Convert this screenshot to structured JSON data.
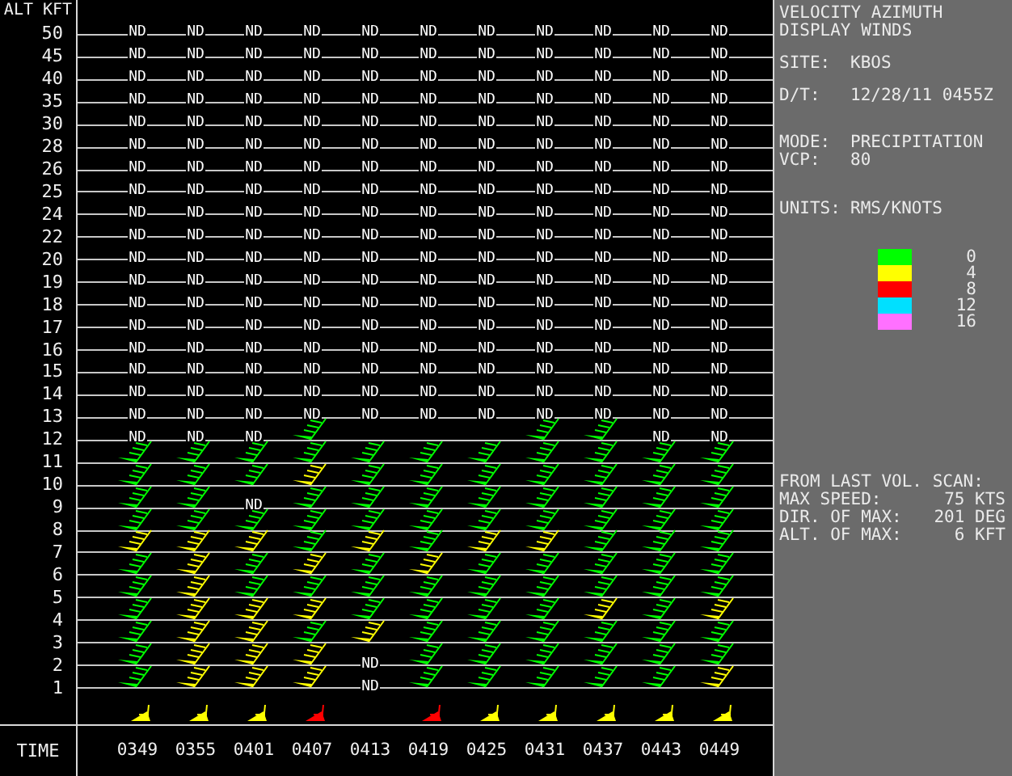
{
  "axis": {
    "title": "ALT KFT",
    "time_label": "TIME"
  },
  "times": [
    "0349",
    "0355",
    "0401",
    "0407",
    "0413",
    "0419",
    "0425",
    "0431",
    "0437",
    "0443",
    "0449"
  ],
  "rows": [
    {
      "label": "50",
      "cells": [
        {
          "kind": "nd",
          "text": "ND"
        },
        {
          "kind": "nd",
          "text": "ND"
        },
        {
          "kind": "nd",
          "text": "ND"
        },
        {
          "kind": "nd",
          "text": "ND"
        },
        {
          "kind": "nd",
          "text": "ND"
        },
        {
          "kind": "nd",
          "text": "ND"
        },
        {
          "kind": "nd",
          "text": "ND"
        },
        {
          "kind": "nd",
          "text": "ND"
        },
        {
          "kind": "nd",
          "text": "ND"
        },
        {
          "kind": "nd",
          "text": "ND"
        },
        {
          "kind": "nd",
          "text": "ND"
        }
      ]
    },
    {
      "label": "45",
      "cells": [
        {
          "kind": "nd",
          "text": "ND"
        },
        {
          "kind": "nd",
          "text": "ND"
        },
        {
          "kind": "nd",
          "text": "ND"
        },
        {
          "kind": "nd",
          "text": "ND"
        },
        {
          "kind": "nd",
          "text": "ND"
        },
        {
          "kind": "nd",
          "text": "ND"
        },
        {
          "kind": "nd",
          "text": "ND"
        },
        {
          "kind": "nd",
          "text": "ND"
        },
        {
          "kind": "nd",
          "text": "ND"
        },
        {
          "kind": "nd",
          "text": "ND"
        },
        {
          "kind": "nd",
          "text": "ND"
        }
      ]
    },
    {
      "label": "40",
      "cells": [
        {
          "kind": "nd",
          "text": "ND"
        },
        {
          "kind": "nd",
          "text": "ND"
        },
        {
          "kind": "nd",
          "text": "ND"
        },
        {
          "kind": "nd",
          "text": "ND"
        },
        {
          "kind": "nd",
          "text": "ND"
        },
        {
          "kind": "nd",
          "text": "ND"
        },
        {
          "kind": "nd",
          "text": "ND"
        },
        {
          "kind": "nd",
          "text": "ND"
        },
        {
          "kind": "nd",
          "text": "ND"
        },
        {
          "kind": "nd",
          "text": "ND"
        },
        {
          "kind": "nd",
          "text": "ND"
        }
      ]
    },
    {
      "label": "35",
      "cells": [
        {
          "kind": "nd",
          "text": "ND"
        },
        {
          "kind": "nd",
          "text": "ND"
        },
        {
          "kind": "nd",
          "text": "ND"
        },
        {
          "kind": "nd",
          "text": "ND"
        },
        {
          "kind": "nd",
          "text": "ND"
        },
        {
          "kind": "nd",
          "text": "ND"
        },
        {
          "kind": "nd",
          "text": "ND"
        },
        {
          "kind": "nd",
          "text": "ND"
        },
        {
          "kind": "nd",
          "text": "ND"
        },
        {
          "kind": "nd",
          "text": "ND"
        },
        {
          "kind": "nd",
          "text": "ND"
        }
      ]
    },
    {
      "label": "30",
      "cells": [
        {
          "kind": "nd",
          "text": "ND"
        },
        {
          "kind": "nd",
          "text": "ND"
        },
        {
          "kind": "nd",
          "text": "ND"
        },
        {
          "kind": "nd",
          "text": "ND"
        },
        {
          "kind": "nd",
          "text": "ND"
        },
        {
          "kind": "nd",
          "text": "ND"
        },
        {
          "kind": "nd",
          "text": "ND"
        },
        {
          "kind": "nd",
          "text": "ND"
        },
        {
          "kind": "nd",
          "text": "ND"
        },
        {
          "kind": "nd",
          "text": "ND"
        },
        {
          "kind": "nd",
          "text": "ND"
        }
      ]
    },
    {
      "label": "28",
      "cells": [
        {
          "kind": "nd",
          "text": "ND"
        },
        {
          "kind": "nd",
          "text": "ND"
        },
        {
          "kind": "nd",
          "text": "ND"
        },
        {
          "kind": "nd",
          "text": "ND"
        },
        {
          "kind": "nd",
          "text": "ND"
        },
        {
          "kind": "nd",
          "text": "ND"
        },
        {
          "kind": "nd",
          "text": "ND"
        },
        {
          "kind": "nd",
          "text": "ND"
        },
        {
          "kind": "nd",
          "text": "ND"
        },
        {
          "kind": "nd",
          "text": "ND"
        },
        {
          "kind": "nd",
          "text": "ND"
        }
      ]
    },
    {
      "label": "26",
      "cells": [
        {
          "kind": "nd",
          "text": "ND"
        },
        {
          "kind": "nd",
          "text": "ND"
        },
        {
          "kind": "nd",
          "text": "ND"
        },
        {
          "kind": "nd",
          "text": "ND"
        },
        {
          "kind": "nd",
          "text": "ND"
        },
        {
          "kind": "nd",
          "text": "ND"
        },
        {
          "kind": "nd",
          "text": "ND"
        },
        {
          "kind": "nd",
          "text": "ND"
        },
        {
          "kind": "nd",
          "text": "ND"
        },
        {
          "kind": "nd",
          "text": "ND"
        },
        {
          "kind": "nd",
          "text": "ND"
        }
      ]
    },
    {
      "label": "25",
      "cells": [
        {
          "kind": "nd",
          "text": "ND"
        },
        {
          "kind": "nd",
          "text": "ND"
        },
        {
          "kind": "nd",
          "text": "ND"
        },
        {
          "kind": "nd",
          "text": "ND"
        },
        {
          "kind": "nd",
          "text": "ND"
        },
        {
          "kind": "nd",
          "text": "ND"
        },
        {
          "kind": "nd",
          "text": "ND"
        },
        {
          "kind": "nd",
          "text": "ND"
        },
        {
          "kind": "nd",
          "text": "ND"
        },
        {
          "kind": "nd",
          "text": "ND"
        },
        {
          "kind": "nd",
          "text": "ND"
        }
      ]
    },
    {
      "label": "24",
      "cells": [
        {
          "kind": "nd",
          "text": "ND"
        },
        {
          "kind": "nd",
          "text": "ND"
        },
        {
          "kind": "nd",
          "text": "ND"
        },
        {
          "kind": "nd",
          "text": "ND"
        },
        {
          "kind": "nd",
          "text": "ND"
        },
        {
          "kind": "nd",
          "text": "ND"
        },
        {
          "kind": "nd",
          "text": "ND"
        },
        {
          "kind": "nd",
          "text": "ND"
        },
        {
          "kind": "nd",
          "text": "ND"
        },
        {
          "kind": "nd",
          "text": "ND"
        },
        {
          "kind": "nd",
          "text": "ND"
        }
      ]
    },
    {
      "label": "22",
      "cells": [
        {
          "kind": "nd",
          "text": "ND"
        },
        {
          "kind": "nd",
          "text": "ND"
        },
        {
          "kind": "nd",
          "text": "ND"
        },
        {
          "kind": "nd",
          "text": "ND"
        },
        {
          "kind": "nd",
          "text": "ND"
        },
        {
          "kind": "nd",
          "text": "ND"
        },
        {
          "kind": "nd",
          "text": "ND"
        },
        {
          "kind": "nd",
          "text": "ND"
        },
        {
          "kind": "nd",
          "text": "ND"
        },
        {
          "kind": "nd",
          "text": "ND"
        },
        {
          "kind": "nd",
          "text": "ND"
        }
      ]
    },
    {
      "label": "20",
      "cells": [
        {
          "kind": "nd",
          "text": "ND"
        },
        {
          "kind": "nd",
          "text": "ND"
        },
        {
          "kind": "nd",
          "text": "ND"
        },
        {
          "kind": "nd",
          "text": "ND"
        },
        {
          "kind": "nd",
          "text": "ND"
        },
        {
          "kind": "nd",
          "text": "ND"
        },
        {
          "kind": "nd",
          "text": "ND"
        },
        {
          "kind": "nd",
          "text": "ND"
        },
        {
          "kind": "nd",
          "text": "ND"
        },
        {
          "kind": "nd",
          "text": "ND"
        },
        {
          "kind": "nd",
          "text": "ND"
        }
      ]
    },
    {
      "label": "19",
      "cells": [
        {
          "kind": "nd",
          "text": "ND"
        },
        {
          "kind": "nd",
          "text": "ND"
        },
        {
          "kind": "nd",
          "text": "ND"
        },
        {
          "kind": "nd",
          "text": "ND"
        },
        {
          "kind": "nd",
          "text": "ND"
        },
        {
          "kind": "nd",
          "text": "ND"
        },
        {
          "kind": "nd",
          "text": "ND"
        },
        {
          "kind": "nd",
          "text": "ND"
        },
        {
          "kind": "nd",
          "text": "ND"
        },
        {
          "kind": "nd",
          "text": "ND"
        },
        {
          "kind": "nd",
          "text": "ND"
        }
      ]
    },
    {
      "label": "18",
      "cells": [
        {
          "kind": "nd",
          "text": "ND"
        },
        {
          "kind": "nd",
          "text": "ND"
        },
        {
          "kind": "nd",
          "text": "ND"
        },
        {
          "kind": "nd",
          "text": "ND"
        },
        {
          "kind": "nd",
          "text": "ND"
        },
        {
          "kind": "nd",
          "text": "ND"
        },
        {
          "kind": "nd",
          "text": "ND"
        },
        {
          "kind": "nd",
          "text": "ND"
        },
        {
          "kind": "nd",
          "text": "ND"
        },
        {
          "kind": "nd",
          "text": "ND"
        },
        {
          "kind": "nd",
          "text": "ND"
        }
      ]
    },
    {
      "label": "17",
      "cells": [
        {
          "kind": "nd",
          "text": "ND"
        },
        {
          "kind": "nd",
          "text": "ND"
        },
        {
          "kind": "nd",
          "text": "ND"
        },
        {
          "kind": "nd",
          "text": "ND"
        },
        {
          "kind": "nd",
          "text": "ND"
        },
        {
          "kind": "nd",
          "text": "ND"
        },
        {
          "kind": "nd",
          "text": "ND"
        },
        {
          "kind": "nd",
          "text": "ND"
        },
        {
          "kind": "nd",
          "text": "ND"
        },
        {
          "kind": "nd",
          "text": "ND"
        },
        {
          "kind": "nd",
          "text": "ND"
        }
      ]
    },
    {
      "label": "16",
      "cells": [
        {
          "kind": "nd",
          "text": "ND"
        },
        {
          "kind": "nd",
          "text": "ND"
        },
        {
          "kind": "nd",
          "text": "ND"
        },
        {
          "kind": "nd",
          "text": "ND"
        },
        {
          "kind": "nd",
          "text": "ND"
        },
        {
          "kind": "nd",
          "text": "ND"
        },
        {
          "kind": "nd",
          "text": "ND"
        },
        {
          "kind": "nd",
          "text": "ND"
        },
        {
          "kind": "nd",
          "text": "ND"
        },
        {
          "kind": "nd",
          "text": "ND"
        },
        {
          "kind": "nd",
          "text": "ND"
        }
      ]
    },
    {
      "label": "15",
      "cells": [
        {
          "kind": "nd",
          "text": "ND"
        },
        {
          "kind": "nd",
          "text": "ND"
        },
        {
          "kind": "nd",
          "text": "ND"
        },
        {
          "kind": "nd",
          "text": "ND"
        },
        {
          "kind": "nd",
          "text": "ND"
        },
        {
          "kind": "nd",
          "text": "ND"
        },
        {
          "kind": "nd",
          "text": "ND"
        },
        {
          "kind": "nd",
          "text": "ND"
        },
        {
          "kind": "nd",
          "text": "ND"
        },
        {
          "kind": "nd",
          "text": "ND"
        },
        {
          "kind": "nd",
          "text": "ND"
        }
      ]
    },
    {
      "label": "14",
      "cells": [
        {
          "kind": "nd",
          "text": "ND"
        },
        {
          "kind": "nd",
          "text": "ND"
        },
        {
          "kind": "nd",
          "text": "ND"
        },
        {
          "kind": "nd",
          "text": "ND"
        },
        {
          "kind": "nd",
          "text": "ND"
        },
        {
          "kind": "nd",
          "text": "ND"
        },
        {
          "kind": "nd",
          "text": "ND"
        },
        {
          "kind": "nd",
          "text": "ND"
        },
        {
          "kind": "nd",
          "text": "ND"
        },
        {
          "kind": "nd",
          "text": "ND"
        },
        {
          "kind": "nd",
          "text": "ND"
        }
      ]
    },
    {
      "label": "13",
      "cells": [
        {
          "kind": "nd",
          "text": "ND"
        },
        {
          "kind": "nd",
          "text": "ND"
        },
        {
          "kind": "nd",
          "text": "ND"
        },
        {
          "kind": "nd",
          "text": "ND"
        },
        {
          "kind": "nd",
          "text": "ND"
        },
        {
          "kind": "nd",
          "text": "ND"
        },
        {
          "kind": "nd",
          "text": "ND"
        },
        {
          "kind": "nd",
          "text": "ND"
        },
        {
          "kind": "nd",
          "text": "ND"
        },
        {
          "kind": "nd",
          "text": "ND"
        },
        {
          "kind": "nd",
          "text": "ND"
        }
      ]
    },
    {
      "label": "12",
      "cells": [
        {
          "kind": "nd",
          "text": "ND"
        },
        {
          "kind": "nd",
          "text": "ND"
        },
        {
          "kind": "nd",
          "text": "ND"
        },
        {
          "kind": "barb",
          "color": "#00ff00"
        },
        {
          "kind": "none"
        },
        {
          "kind": "none"
        },
        {
          "kind": "none"
        },
        {
          "kind": "barb",
          "color": "#00ff00"
        },
        {
          "kind": "barb",
          "color": "#00ff00"
        },
        {
          "kind": "nd",
          "text": "ND"
        },
        {
          "kind": "nd",
          "text": "ND"
        }
      ]
    },
    {
      "label": "11",
      "cells": [
        {
          "kind": "barb",
          "color": "#00ff00"
        },
        {
          "kind": "barb",
          "color": "#00ff00"
        },
        {
          "kind": "barb",
          "color": "#00ff00"
        },
        {
          "kind": "barb",
          "color": "#00ff00"
        },
        {
          "kind": "barb",
          "color": "#00ff00"
        },
        {
          "kind": "barb",
          "color": "#00ff00"
        },
        {
          "kind": "barb",
          "color": "#00ff00"
        },
        {
          "kind": "barb",
          "color": "#00ff00"
        },
        {
          "kind": "barb",
          "color": "#00ff00"
        },
        {
          "kind": "barb",
          "color": "#00ff00"
        },
        {
          "kind": "barb",
          "color": "#00ff00"
        }
      ]
    },
    {
      "label": "10",
      "cells": [
        {
          "kind": "barb",
          "color": "#00ff00"
        },
        {
          "kind": "barb",
          "color": "#00ff00"
        },
        {
          "kind": "barb",
          "color": "#00ff00"
        },
        {
          "kind": "barb",
          "color": "#ffff00"
        },
        {
          "kind": "barb",
          "color": "#00ff00"
        },
        {
          "kind": "barb",
          "color": "#00ff00"
        },
        {
          "kind": "barb",
          "color": "#00ff00"
        },
        {
          "kind": "barb",
          "color": "#00ff00"
        },
        {
          "kind": "barb",
          "color": "#00ff00"
        },
        {
          "kind": "barb",
          "color": "#00ff00"
        },
        {
          "kind": "barb",
          "color": "#00ff00"
        }
      ]
    },
    {
      "label": "9",
      "cells": [
        {
          "kind": "barb",
          "color": "#00ff00"
        },
        {
          "kind": "barb",
          "color": "#00ff00"
        },
        {
          "kind": "nd",
          "text": "ND"
        },
        {
          "kind": "barb",
          "color": "#00ff00"
        },
        {
          "kind": "barb",
          "color": "#00ff00"
        },
        {
          "kind": "barb",
          "color": "#00ff00"
        },
        {
          "kind": "barb",
          "color": "#00ff00"
        },
        {
          "kind": "barb",
          "color": "#00ff00"
        },
        {
          "kind": "barb",
          "color": "#00ff00"
        },
        {
          "kind": "barb",
          "color": "#00ff00"
        },
        {
          "kind": "barb",
          "color": "#00ff00"
        }
      ]
    },
    {
      "label": "8",
      "cells": [
        {
          "kind": "barb",
          "color": "#00ff00"
        },
        {
          "kind": "barb",
          "color": "#00ff00"
        },
        {
          "kind": "barb",
          "color": "#00ff00"
        },
        {
          "kind": "barb",
          "color": "#00ff00"
        },
        {
          "kind": "barb",
          "color": "#00ff00"
        },
        {
          "kind": "barb",
          "color": "#00ff00"
        },
        {
          "kind": "barb",
          "color": "#00ff00"
        },
        {
          "kind": "barb",
          "color": "#00ff00"
        },
        {
          "kind": "barb",
          "color": "#00ff00"
        },
        {
          "kind": "barb",
          "color": "#00ff00"
        },
        {
          "kind": "barb",
          "color": "#00ff00"
        }
      ]
    },
    {
      "label": "7",
      "cells": [
        {
          "kind": "barb",
          "color": "#ffff00"
        },
        {
          "kind": "barb",
          "color": "#ffff00"
        },
        {
          "kind": "barb",
          "color": "#ffff00"
        },
        {
          "kind": "barb",
          "color": "#00ff00"
        },
        {
          "kind": "barb",
          "color": "#ffff00"
        },
        {
          "kind": "barb",
          "color": "#00ff00"
        },
        {
          "kind": "barb",
          "color": "#ffff00"
        },
        {
          "kind": "barb",
          "color": "#ffff00"
        },
        {
          "kind": "barb",
          "color": "#00ff00"
        },
        {
          "kind": "barb",
          "color": "#00ff00"
        },
        {
          "kind": "barb",
          "color": "#00ff00"
        }
      ]
    },
    {
      "label": "6",
      "cells": [
        {
          "kind": "barb",
          "color": "#00ff00"
        },
        {
          "kind": "barb",
          "color": "#ffff00"
        },
        {
          "kind": "barb",
          "color": "#00ff00"
        },
        {
          "kind": "barb",
          "color": "#ffff00"
        },
        {
          "kind": "barb",
          "color": "#00ff00"
        },
        {
          "kind": "barb",
          "color": "#ffff00"
        },
        {
          "kind": "barb",
          "color": "#00ff00"
        },
        {
          "kind": "barb",
          "color": "#00ff00"
        },
        {
          "kind": "barb",
          "color": "#00ff00"
        },
        {
          "kind": "barb",
          "color": "#00ff00"
        },
        {
          "kind": "barb",
          "color": "#00ff00"
        }
      ]
    },
    {
      "label": "5",
      "cells": [
        {
          "kind": "barb",
          "color": "#00ff00"
        },
        {
          "kind": "barb",
          "color": "#ffff00"
        },
        {
          "kind": "barb",
          "color": "#00ff00"
        },
        {
          "kind": "barb",
          "color": "#00ff00"
        },
        {
          "kind": "barb",
          "color": "#00ff00"
        },
        {
          "kind": "barb",
          "color": "#00ff00"
        },
        {
          "kind": "barb",
          "color": "#00ff00"
        },
        {
          "kind": "barb",
          "color": "#00ff00"
        },
        {
          "kind": "barb",
          "color": "#00ff00"
        },
        {
          "kind": "barb",
          "color": "#00ff00"
        },
        {
          "kind": "barb",
          "color": "#00ff00"
        }
      ]
    },
    {
      "label": "4",
      "cells": [
        {
          "kind": "barb",
          "color": "#00ff00"
        },
        {
          "kind": "barb",
          "color": "#ffff00"
        },
        {
          "kind": "barb",
          "color": "#ffff00"
        },
        {
          "kind": "barb",
          "color": "#ffff00"
        },
        {
          "kind": "barb",
          "color": "#00ff00"
        },
        {
          "kind": "barb",
          "color": "#00ff00"
        },
        {
          "kind": "barb",
          "color": "#00ff00"
        },
        {
          "kind": "barb",
          "color": "#00ff00"
        },
        {
          "kind": "barb",
          "color": "#ffff00"
        },
        {
          "kind": "barb",
          "color": "#00ff00"
        },
        {
          "kind": "barb",
          "color": "#ffff00"
        }
      ]
    },
    {
      "label": "3",
      "cells": [
        {
          "kind": "barb",
          "color": "#00ff00"
        },
        {
          "kind": "barb",
          "color": "#ffff00"
        },
        {
          "kind": "barb",
          "color": "#ffff00"
        },
        {
          "kind": "barb",
          "color": "#00ff00"
        },
        {
          "kind": "barb",
          "color": "#ffff00"
        },
        {
          "kind": "barb",
          "color": "#00ff00"
        },
        {
          "kind": "barb",
          "color": "#00ff00"
        },
        {
          "kind": "barb",
          "color": "#00ff00"
        },
        {
          "kind": "barb",
          "color": "#00ff00"
        },
        {
          "kind": "barb",
          "color": "#00ff00"
        },
        {
          "kind": "barb",
          "color": "#00ff00"
        }
      ]
    },
    {
      "label": "2",
      "cells": [
        {
          "kind": "barb",
          "color": "#00ff00"
        },
        {
          "kind": "barb",
          "color": "#ffff00"
        },
        {
          "kind": "barb",
          "color": "#ffff00"
        },
        {
          "kind": "barb",
          "color": "#ffff00"
        },
        {
          "kind": "nd",
          "text": "ND"
        },
        {
          "kind": "barb",
          "color": "#00ff00"
        },
        {
          "kind": "barb",
          "color": "#00ff00"
        },
        {
          "kind": "barb",
          "color": "#00ff00"
        },
        {
          "kind": "barb",
          "color": "#00ff00"
        },
        {
          "kind": "barb",
          "color": "#00ff00"
        },
        {
          "kind": "barb",
          "color": "#00ff00"
        }
      ]
    },
    {
      "label": "1",
      "cells": [
        {
          "kind": "barb",
          "color": "#00ff00"
        },
        {
          "kind": "barb",
          "color": "#ffff00"
        },
        {
          "kind": "barb",
          "color": "#ffff00"
        },
        {
          "kind": "barb",
          "color": "#ffff00"
        },
        {
          "kind": "nd",
          "text": "ND"
        },
        {
          "kind": "barb",
          "color": "#00ff00"
        },
        {
          "kind": "barb",
          "color": "#00ff00"
        },
        {
          "kind": "barb",
          "color": "#00ff00"
        },
        {
          "kind": "barb",
          "color": "#00ff00"
        },
        {
          "kind": "barb",
          "color": "#00ff00"
        },
        {
          "kind": "barb",
          "color": "#ffff00"
        }
      ]
    },
    {
      "kind": "surface",
      "cells": [
        {
          "kind": "barb",
          "color": "#ffff00"
        },
        {
          "kind": "barb",
          "color": "#ffff00"
        },
        {
          "kind": "barb",
          "color": "#ffff00"
        },
        {
          "kind": "barb",
          "color": "#ff0000"
        },
        {
          "kind": "none"
        },
        {
          "kind": "barb",
          "color": "#ff0000"
        },
        {
          "kind": "barb",
          "color": "#ffff00"
        },
        {
          "kind": "barb",
          "color": "#ffff00"
        },
        {
          "kind": "barb",
          "color": "#ffff00"
        },
        {
          "kind": "barb",
          "color": "#ffff00"
        },
        {
          "kind": "barb",
          "color": "#ffff00"
        }
      ]
    }
  ],
  "panel": {
    "title_lines": [
      "VELOCITY AZIMUTH",
      "DISPLAY WINDS"
    ],
    "groups": [
      [
        {
          "label": "SITE:",
          "value": "KBOS"
        }
      ],
      [
        {
          "label": "D/T:",
          "value": "12/28/11 0455Z"
        }
      ],
      [
        {
          "label": "MODE:",
          "value": "PRECIPITATION"
        },
        {
          "label": "VCP:",
          "value": "80"
        }
      ],
      [
        {
          "label": "UNITS:",
          "value": "RMS/KNOTS"
        }
      ]
    ],
    "legend": [
      {
        "value": "0",
        "color": "#00ff00"
      },
      {
        "value": "4",
        "color": "#ffff00"
      },
      {
        "value": "8",
        "color": "#ff0000"
      },
      {
        "value": "12",
        "color": "#00e0ff"
      },
      {
        "value": "16",
        "color": "#ff70ff"
      }
    ],
    "scan_heading": "FROM LAST VOL. SCAN:",
    "scan": [
      {
        "label": "MAX SPEED:",
        "value": "75 KTS"
      },
      {
        "label": "DIR. OF MAX:",
        "value": "201 DEG"
      },
      {
        "label": "ALT. OF MAX:",
        "value": "6 KFT"
      }
    ]
  }
}
